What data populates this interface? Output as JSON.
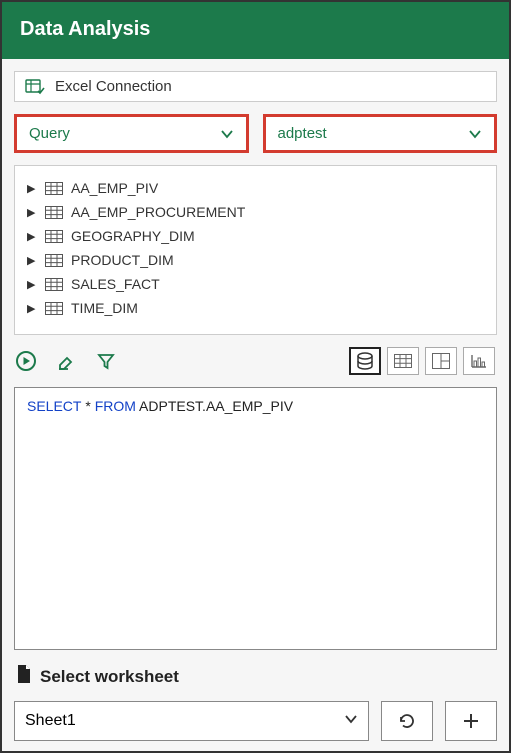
{
  "title": "Data Analysis",
  "connection": {
    "label": "Excel Connection"
  },
  "dropdowns": {
    "mode": "Query",
    "schema": "adptest"
  },
  "tables": [
    "AA_EMP_PIV",
    "AA_EMP_PROCUREMENT",
    "GEOGRAPHY_DIM",
    "PRODUCT_DIM",
    "SALES_FACT",
    "TIME_DIM"
  ],
  "sql": {
    "kw1": "SELECT",
    "star": " * ",
    "kw2": "FROM",
    "rest": " ADPTEST.AA_EMP_PIV"
  },
  "worksheet": {
    "label": "Select worksheet",
    "selected": "Sheet1"
  }
}
